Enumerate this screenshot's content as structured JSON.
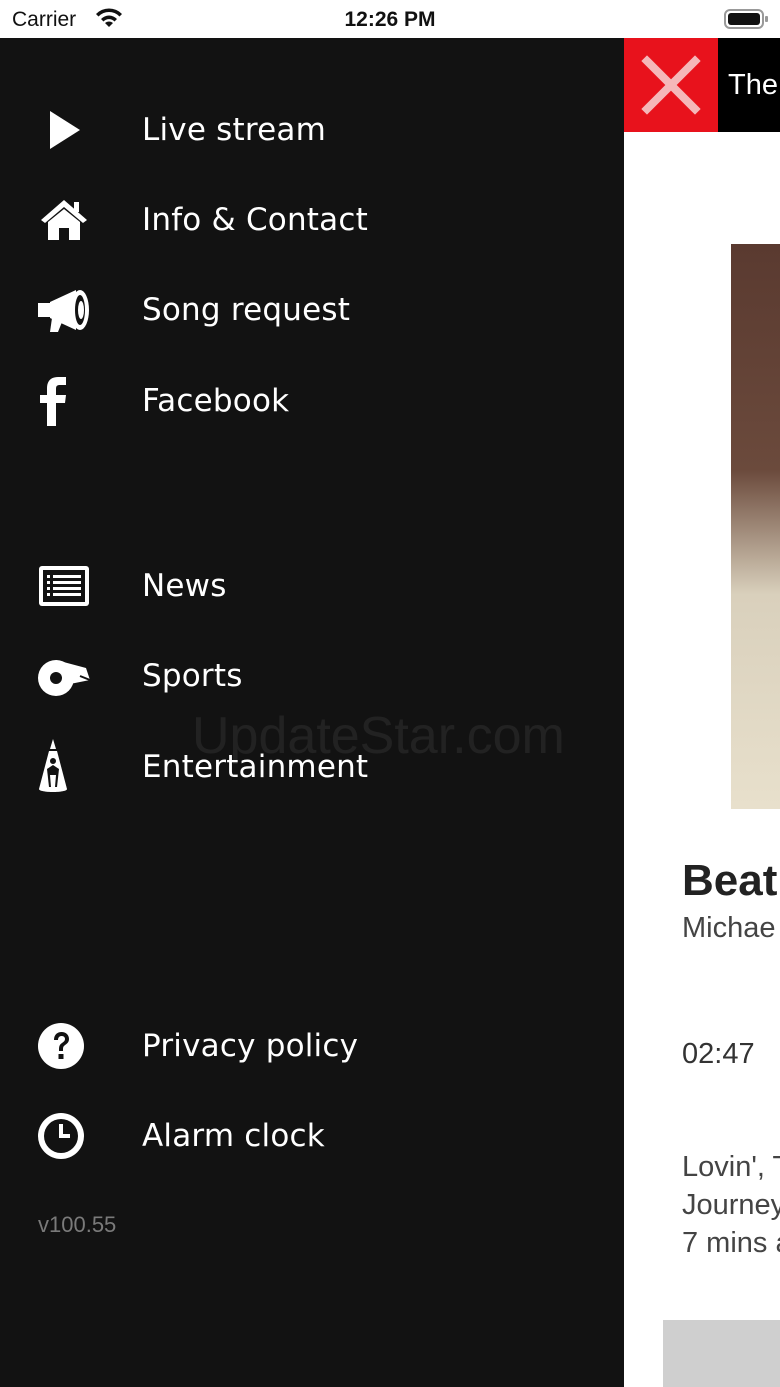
{
  "status_bar": {
    "carrier": "Carrier",
    "time": "12:26 PM"
  },
  "drawer": {
    "items": [
      {
        "label": "Live stream",
        "icon": "play-icon"
      },
      {
        "label": "Info & Contact",
        "icon": "home-icon"
      },
      {
        "label": "Song request",
        "icon": "megaphone-icon"
      },
      {
        "label": "Facebook",
        "icon": "facebook-icon"
      },
      {
        "label": "News",
        "icon": "news-icon"
      },
      {
        "label": "Sports",
        "icon": "whistle-icon"
      },
      {
        "label": "Entertainment",
        "icon": "spotlight-icon"
      },
      {
        "label": "Privacy policy",
        "icon": "question-icon"
      },
      {
        "label": "Alarm clock",
        "icon": "clock-icon"
      }
    ],
    "version": "v100.55",
    "watermark": "UpdateStar.com"
  },
  "main": {
    "title_fragment": "The",
    "track_title_fragment": "Beat",
    "track_artist_fragment": "Michae",
    "track_time": "02:47",
    "history_lines": [
      "Lovin', T",
      "Journey",
      "7 mins a"
    ]
  },
  "colors": {
    "drawer_bg": "#121212",
    "close_bg": "#e8121c",
    "title_bg": "#000000"
  }
}
